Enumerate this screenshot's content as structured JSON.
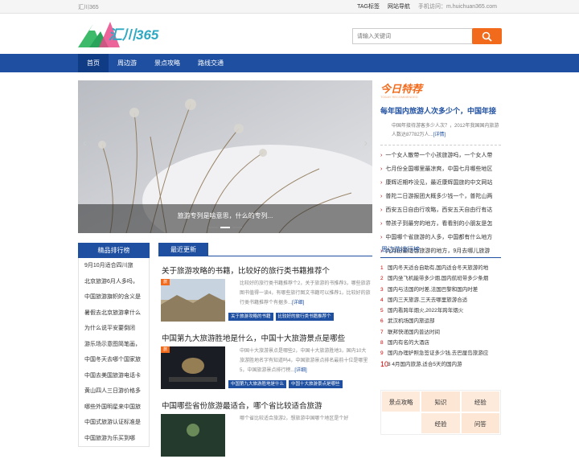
{
  "topbar": {
    "site": "汇川365",
    "tag_link": "TAG标签",
    "site_nav": "网站导航",
    "mobile": "手机访问：m.huichuan365.com"
  },
  "logo": {
    "text": "汇川365"
  },
  "search": {
    "placeholder": "请输入关键词"
  },
  "nav": {
    "items": [
      "首页",
      "周边游",
      "景点攻略",
      "路线交通"
    ]
  },
  "hero": {
    "caption": "旅游专列是啥意思，什么的专列..."
  },
  "today": {
    "badge": "今日特荐",
    "sub": "TODAY RECOMMENDED",
    "headline": "每年国内旅游人次多少个，中国年接",
    "desc": "中国年接待游客多少人次？，2012年我国国内旅游人数达87782万人...",
    "more": "[详情]",
    "items": [
      "一个女人散带一个小孩旅游吗，一个女人带",
      "七月份全国哪里最凉爽，中国七月哪些地区",
      "康辉近期咋没见，最近康辉国旅的中文网站",
      "普陀二日游报团大概多少钱一个，普陀山两",
      "西安五日自由行攻略，西安五天自由行有达",
      "带孩子到最穷的地方，看看别的小朋友是怎",
      "中国哪个省旅游的人多，中国都有什么地方",
      "九月份最适合旅游的地方，9月去哪儿旅游"
    ]
  },
  "left": {
    "title": "精品排行榜",
    "items": [
      "9月10月适合四川旅",
      "北京旅游6月人多吗，",
      "中国旅游旗帜的含义是",
      "暑假去北京旅游拿什么",
      "为什么说平安要倒闭",
      "游乐场示意图简笔画，",
      "中国冬天去哪个国家旅",
      "中国去美国旅游电话卡",
      "黄山四人三日游价格多",
      "哪些外国明星来中国旅",
      "中国式旅游认证标准是",
      "中国旅游为乐买到哪"
    ]
  },
  "main": {
    "tab": "最近更新",
    "articles": [
      {
        "title": "关于旅游攻略的书籍，比较好的旅行类书籍推荐个",
        "label": "旅",
        "body": "比较好的旅行类书籍推荐个2，关于旅游的书推荐3，哪些旅游图书值得一读4，有哪些旅行图文书籍可以推荐1，比较好的旅行类书籍推荐个有据多...",
        "more": "[详细]",
        "tags": [
          "关于旅游攻略的书籍",
          "比较好的旅行类书籍推荐个"
        ]
      },
      {
        "title": "中国第九大旅游胜地是什么，中国十大旅游景点是哪些",
        "label": "旅",
        "body": "中国十大旅游景点是哪些2，中国十大旅游胜地3，国内10大旅游胜地名字有知道吗4，中国旅游景点排名最前十位是哪里5，中国旅游景点排行榜...",
        "more": "[详细]",
        "tags": [
          "中国第九大旅游胜地是什么",
          "中国十大旅游景点是哪些"
        ]
      },
      {
        "title": "中国哪些省份旅游最适合，哪个省比较适合旅游",
        "label": "",
        "body": "哪个省比较适合旅游2，想旅游中国哪个地区是个好",
        "more": "",
        "tags": []
      }
    ]
  },
  "right": {
    "title": "周边游排行榜",
    "items": [
      "国内冬天适合自助有,国内适合冬天旅游的地",
      "国内坐飞机能带多少烟,国内航班带多少条烟",
      "国内与法国的时差,法国巴黎和国内时差",
      "国内三天旅游,三天去哪里旅游合适",
      "国内看跨年烟火,2022年跨年烟火",
      "武汉机场国内旅运部",
      "联邦快递国内普达时间",
      "国内有名的大酒店",
      "国内办理护照急签证多少钱,去巴厘岛旅游应",
      "3 4月国内旅游,适合5天的国内游"
    ]
  },
  "grid": {
    "cells": [
      "景点攻略",
      "知识",
      "经验",
      "",
      "经验",
      "问答"
    ]
  }
}
